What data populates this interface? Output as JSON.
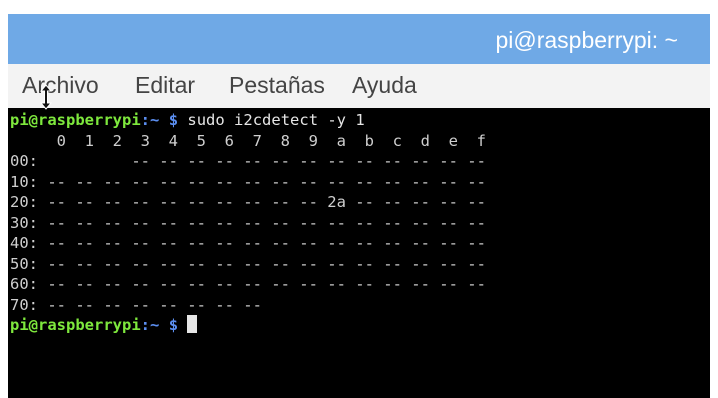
{
  "window": {
    "title": "pi@raspberrypi: ~"
  },
  "menu": {
    "items": [
      "Archivo",
      "Editar",
      "Pestañas",
      "Ayuda"
    ]
  },
  "terminal": {
    "prompt_user": "pi@raspberrypi",
    "prompt_sep": ":",
    "prompt_path": "~",
    "prompt_dollar": "$",
    "command": "sudo i2cdetect -y 1",
    "lines": [
      "     0  1  2  3  4  5  6  7  8  9  a  b  c  d  e  f",
      "00:          -- -- -- -- -- -- -- -- -- -- -- -- --",
      "10: -- -- -- -- -- -- -- -- -- -- -- -- -- -- -- --",
      "20: -- -- -- -- -- -- -- -- -- -- 2a -- -- -- -- --",
      "30: -- -- -- -- -- -- -- -- -- -- -- -- -- -- -- --",
      "40: -- -- -- -- -- -- -- -- -- -- -- -- -- -- -- --",
      "50: -- -- -- -- -- -- -- -- -- -- -- -- -- -- -- --",
      "60: -- -- -- -- -- -- -- -- -- -- -- -- -- -- -- --",
      "70: -- -- -- -- -- -- -- --"
    ]
  },
  "icons": {
    "mouse_cursor": "vertical-resize-cursor-icon"
  },
  "colors": {
    "titlebar": "#6fa9e6",
    "terminal_bg": "#000000",
    "prompt_user": "#7ee83d",
    "prompt_path": "#5b8ef0"
  }
}
